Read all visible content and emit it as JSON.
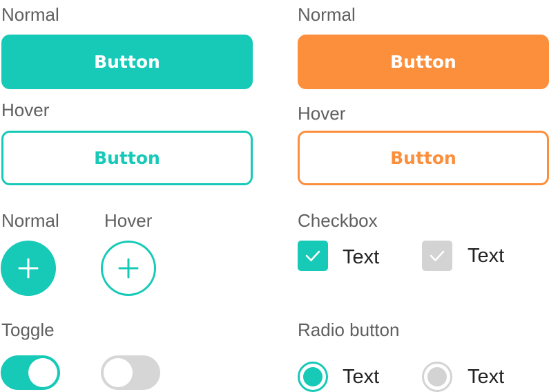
{
  "colors": {
    "teal": "#17c9b7",
    "orange": "#fb8f3b",
    "disabled": "#d3d3d3",
    "label": "#5f5f5f"
  },
  "left_column": {
    "normal_label": "Normal",
    "normal_button": "Button",
    "hover_label": "Hover",
    "hover_button": "Button",
    "fab_normal_label": "Normal",
    "fab_hover_label": "Hover",
    "fab_icon": "plus-icon",
    "toggle_label": "Toggle",
    "toggle_on": true,
    "toggle_off": false
  },
  "right_column": {
    "normal_label": "Normal",
    "normal_button": "Button",
    "hover_label": "Hover",
    "hover_button": "Button",
    "checkbox_label": "Checkbox",
    "checkbox_checked_text": "Text",
    "checkbox_disabled_text": "Text",
    "radio_label": "Radio button",
    "radio_selected_text": "Text",
    "radio_disabled_text": "Text"
  }
}
